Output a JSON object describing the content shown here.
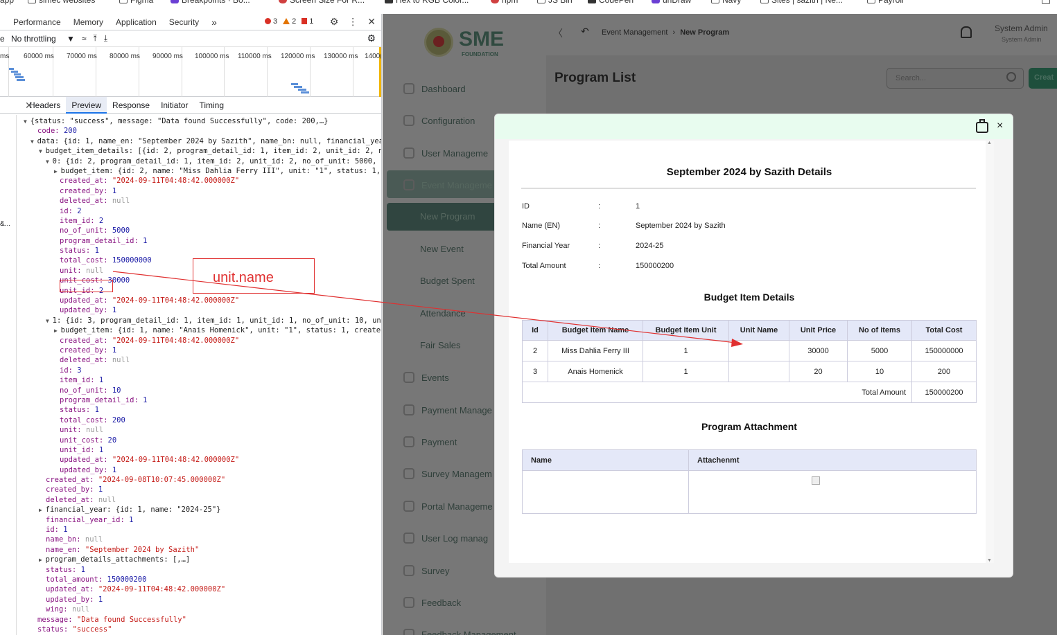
{
  "bookmarks": [
    "app",
    "simec websites",
    "Figma",
    "Breakpoints · Bo...",
    "Screen Size For R...",
    "Hex to RGB Color...",
    "npm",
    "JS Bin",
    "CodePen",
    "unDraw",
    "Navy",
    "Sites | sazith | Ne...",
    "Payroll"
  ],
  "devtools": {
    "tabs": [
      "Performance",
      "Memory",
      "Application",
      "Security"
    ],
    "more": "»",
    "errors": "3",
    "warnings": "2",
    "issues": "1",
    "throttle_prefix": "e",
    "throttle": "No throttling",
    "ticks": [
      "ms",
      "60000 ms",
      "70000 ms",
      "80000 ms",
      "90000 ms",
      "100000 ms",
      "110000 ms",
      "120000 ms",
      "130000 ms",
      "1400("
    ],
    "subtabs": [
      "Headers",
      "Preview",
      "Response",
      "Initiator",
      "Timing"
    ],
    "active_subtab": "Preview",
    "gutter_text": "&...",
    "annotation": "unit.name",
    "lines": [
      [
        "▼ ",
        "{status: \"success\", message: \"Data found Successfully\", code: 200,…}"
      ],
      [
        "  ",
        "code: ",
        "200",
        "n"
      ],
      [
        "▼ ",
        "data: {id: 1, name_en: \"September 2024 by Sazith\", name_bn: null, financial_year_id:"
      ],
      [
        "  ▼ ",
        "budget_item_details: [{id: 2, program_detail_id: 1, item_id: 2, unit_id: 2, no_of_"
      ],
      [
        "    ▼ ",
        "0: {id: 2, program_detail_id: 1, item_id: 2, unit_id: 2, no_of_unit: 5000, unit_"
      ],
      [
        "      ▶ ",
        "budget_item: {id: 2, name: \"Miss Dahlia Ferry III\", unit: \"1\", status: 1, crea"
      ],
      [
        "        ",
        "created_at: ",
        "\"2024-09-11T04:48:42.000000Z\"",
        "s"
      ],
      [
        "        ",
        "created_by: ",
        "1",
        "n"
      ],
      [
        "        ",
        "deleted_at: ",
        "null",
        "nul"
      ],
      [
        "        ",
        "id: ",
        "2",
        "n"
      ],
      [
        "        ",
        "item_id: ",
        "2",
        "n"
      ],
      [
        "        ",
        "no_of_unit: ",
        "5000",
        "n"
      ],
      [
        "        ",
        "program_detail_id: ",
        "1",
        "n"
      ],
      [
        "        ",
        "status: ",
        "1",
        "n"
      ],
      [
        "        ",
        "total_cost: ",
        "150000000",
        "n"
      ],
      [
        "        ",
        "unit: ",
        "null",
        "nul"
      ],
      [
        "        ",
        "unit_cost: ",
        "30000",
        "n"
      ],
      [
        "        ",
        "unit_id: ",
        "2",
        "n"
      ],
      [
        "        ",
        "updated_at: ",
        "\"2024-09-11T04:48:42.000000Z\"",
        "s"
      ],
      [
        "        ",
        "updated_by: ",
        "1",
        "n"
      ],
      [
        "    ▼ ",
        "1: {id: 3, program_detail_id: 1, item_id: 1, unit_id: 1, no_of_unit: 10, unit_co"
      ],
      [
        "      ▶ ",
        "budget_item: {id: 1, name: \"Anais Homenick\", unit: \"1\", status: 1, created_by:"
      ],
      [
        "        ",
        "created_at: ",
        "\"2024-09-11T04:48:42.000000Z\"",
        "s"
      ],
      [
        "        ",
        "created_by: ",
        "1",
        "n"
      ],
      [
        "        ",
        "deleted_at: ",
        "null",
        "nul"
      ],
      [
        "        ",
        "id: ",
        "3",
        "n"
      ],
      [
        "        ",
        "item_id: ",
        "1",
        "n"
      ],
      [
        "        ",
        "no_of_unit: ",
        "10",
        "n"
      ],
      [
        "        ",
        "program_detail_id: ",
        "1",
        "n"
      ],
      [
        "        ",
        "status: ",
        "1",
        "n"
      ],
      [
        "        ",
        "total_cost: ",
        "200",
        "n"
      ],
      [
        "        ",
        "unit: ",
        "null",
        "nul"
      ],
      [
        "        ",
        "unit_cost: ",
        "20",
        "n"
      ],
      [
        "        ",
        "unit_id: ",
        "1",
        "n"
      ],
      [
        "        ",
        "updated_at: ",
        "\"2024-09-11T04:48:42.000000Z\"",
        "s"
      ],
      [
        "        ",
        "updated_by: ",
        "1",
        "n"
      ],
      [
        "     ",
        "created_at: ",
        "\"2024-09-08T10:07:45.000000Z\"",
        "s"
      ],
      [
        "     ",
        "created_by: ",
        "1",
        "n"
      ],
      [
        "     ",
        "deleted_at: ",
        "null",
        "nul"
      ],
      [
        "   ▶ ",
        "financial_year: {id: 1, name: \"2024-25\"}"
      ],
      [
        "     ",
        "financial_year_id: ",
        "1",
        "n"
      ],
      [
        "     ",
        "id: ",
        "1",
        "n"
      ],
      [
        "     ",
        "name_bn: ",
        "null",
        "nul"
      ],
      [
        "     ",
        "name_en: ",
        "\"September 2024 by Sazith\"",
        "s"
      ],
      [
        "   ▶ ",
        "program_details_attachments: [,…]"
      ],
      [
        "     ",
        "status: ",
        "1",
        "n"
      ],
      [
        "     ",
        "total_amount: ",
        "150000200",
        "n"
      ],
      [
        "     ",
        "updated_at: ",
        "\"2024-09-11T04:48:42.000000Z\"",
        "s"
      ],
      [
        "     ",
        "updated_by: ",
        "1",
        "n"
      ],
      [
        "     ",
        "wing: ",
        "null",
        "nul"
      ],
      [
        "  ",
        "message: ",
        "\"Data found Successfully\"",
        "s"
      ],
      [
        "  ",
        "status: ",
        "\"success\"",
        "s"
      ]
    ]
  },
  "app": {
    "logo_text": "SME",
    "logo_sub": "FOUNDATION",
    "breadcrumb": [
      "Event Management",
      "New Program"
    ],
    "user": "System Admin",
    "role": "System Admin",
    "page_title": "Program List",
    "search_placeholder": "Search...",
    "create_label": "Creat",
    "sidebar": [
      "Dashboard",
      "Configuration",
      "User Manageme",
      "Event Manageme",
      "New Program",
      "New Event",
      "Budget Spent",
      "Attendance",
      "Fair Sales",
      "Events",
      "Payment Manage",
      "Payment",
      "Survey Managem",
      "Portal Manageme",
      "User Log manag",
      "Survey",
      "Feedback",
      "Feedback Management"
    ]
  },
  "modal": {
    "title": "September 2024 by Sazith Details",
    "info": [
      [
        "ID",
        ":",
        "1"
      ],
      [
        "Name (EN)",
        ":",
        "September 2024 by Sazith"
      ],
      [
        "Financial Year",
        ":",
        "2024-25"
      ],
      [
        "Total Amount",
        ":",
        "150000200"
      ]
    ],
    "budget_title": "Budget Item Details",
    "budget_headers": [
      "Id",
      "Budget Item Name",
      "Budget Item Unit",
      "Unit Name",
      "Unit Price",
      "No of items",
      "Total Cost"
    ],
    "budget_rows": [
      [
        "2",
        "Miss Dahlia Ferry III",
        "1",
        "",
        "30000",
        "5000",
        "150000000"
      ],
      [
        "3",
        "Anais Homenick",
        "1",
        "",
        "20",
        "10",
        "200"
      ]
    ],
    "total_label": "Total Amount",
    "total_value": "150000200",
    "attach_title": "Program Attachment",
    "attach_headers": [
      "Name",
      "Attachenmt"
    ]
  }
}
